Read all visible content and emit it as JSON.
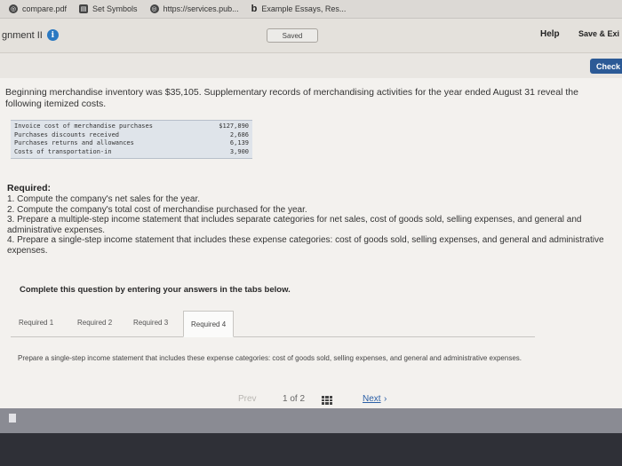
{
  "bookmarks": [
    {
      "label": "compare.pdf",
      "icon": "globe-icon"
    },
    {
      "label": "Set Symbols",
      "icon": "book-icon"
    },
    {
      "label": "https://services.pub...",
      "icon": "globe-icon"
    },
    {
      "label": "Example Essays, Res...",
      "icon": "b-icon"
    }
  ],
  "header": {
    "assignment_title": "gnment II",
    "saved": "Saved",
    "help": "Help",
    "save_exit": "Save & Exi"
  },
  "check_label": "Check",
  "problem": {
    "intro": "Beginning merchandise inventory was $35,105. Supplementary records of merchandising activities for the year ended August 31 reveal the following itemized costs.",
    "rows": [
      {
        "label": "Invoice cost of merchandise purchases",
        "value": "$127,890"
      },
      {
        "label": "Purchases discounts received",
        "value": "2,686"
      },
      {
        "label": "Purchases returns and allowances",
        "value": "6,139"
      },
      {
        "label": "Costs of transportation-in",
        "value": "3,900"
      }
    ],
    "required_heading": "Required:",
    "required_items": [
      "1. Compute the company's net sales for the year.",
      "2. Compute the company's total cost of merchandise purchased for the year.",
      "3. Prepare a multiple-step income statement that includes separate categories for net sales, cost of goods sold, selling expenses, and general and administrative expenses.",
      "4. Prepare a single-step income statement that includes these expense categories: cost of goods sold, selling expenses, and general and administrative expenses."
    ],
    "complete_instruction": "Complete this question by entering your answers in the tabs below."
  },
  "tabs": [
    {
      "label": "Required 1"
    },
    {
      "label": "Required 2"
    },
    {
      "label": "Required 3"
    },
    {
      "label": "Required 4"
    }
  ],
  "active_tab_description": "Prepare a single-step income statement that includes these expense categories: cost of goods sold, selling expenses, and general and administrative expenses.",
  "pager": {
    "prev": "Prev",
    "current": "1",
    "of": "of",
    "total": "2",
    "next": "Next"
  }
}
